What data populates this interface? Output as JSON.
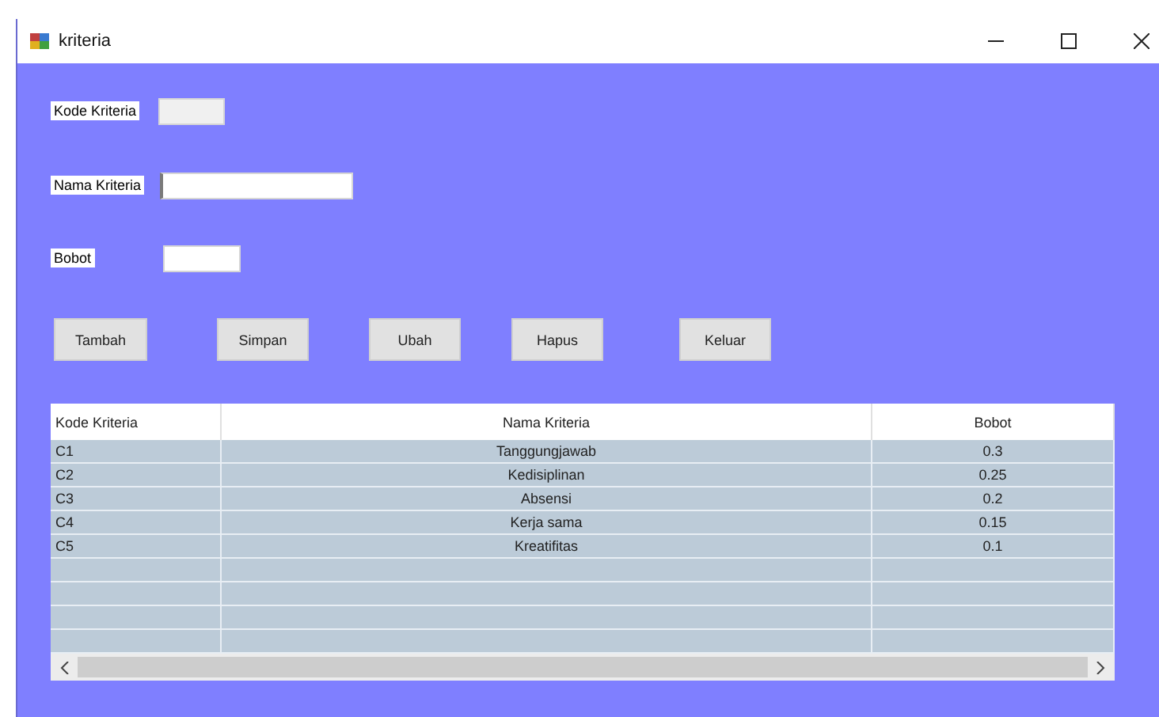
{
  "window": {
    "title": "kriteria"
  },
  "fields": [
    {
      "label": "Kode Kriteria",
      "disabled": true
    },
    {
      "label": "Nama Kriteria",
      "disabled": false,
      "focused": true
    },
    {
      "label": "Bobot",
      "disabled": false
    }
  ],
  "buttons": [
    "Tambah",
    "Simpan",
    "Ubah",
    "Hapus",
    "Keluar"
  ],
  "table": {
    "columns": [
      "Kode Kriteria",
      "Nama Kriteria",
      "Bobot"
    ],
    "rows": [
      [
        "C1",
        "Tanggungjawab",
        "0.3"
      ],
      [
        "C2",
        "Kedisiplinan",
        "0.25"
      ],
      [
        "C3",
        "Absensi",
        "0.2"
      ],
      [
        "C4",
        "Kerja sama",
        "0.15"
      ],
      [
        "C5",
        "Kreatifitas",
        "0.1"
      ]
    ]
  }
}
